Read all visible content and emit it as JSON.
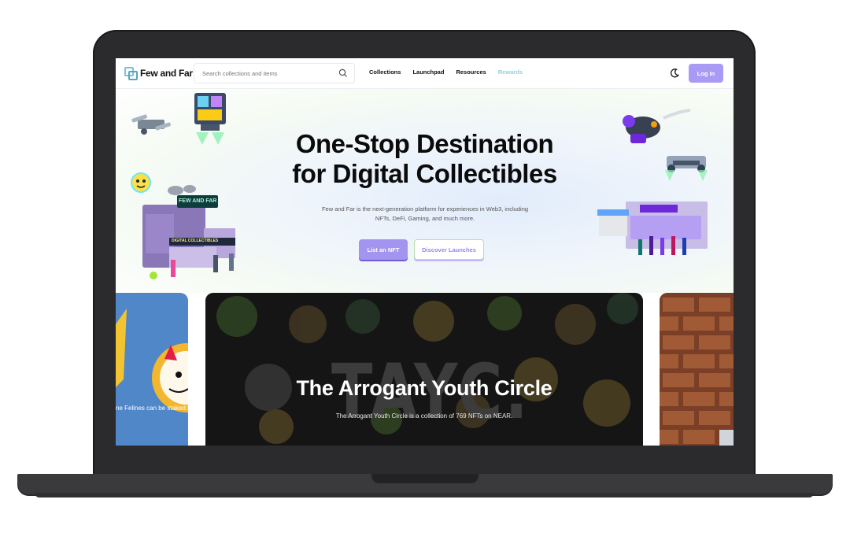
{
  "nav": {
    "logo_text": "Few and Far",
    "search_placeholder": "Search collections and items",
    "links": [
      {
        "label": "Collections"
      },
      {
        "label": "Launchpad"
      },
      {
        "label": "Resources"
      },
      {
        "label": "Rewards"
      }
    ],
    "login_label": "Log In"
  },
  "hero": {
    "title_line1": "One-Stop Destination",
    "title_line2": "for Digital Collectibles",
    "subtitle": "Few and Far is the next-generation platform for experiences in Web3, including NFTs, DeFi, Gaming, and much more.",
    "primary_button": "List an NFT",
    "secondary_button": "Discover Launches",
    "sign_text": "FEW AND FAR",
    "sign_text_2": "DIGITAL COLLECTIBLES"
  },
  "carousel": {
    "left_caption": "ne Felines can be staked to",
    "main_title": "The Arrogant Youth Circle",
    "main_desc": "The Arrogant Youth Circle is a collection of 769 NFTs on NEAR.",
    "main_bg_text": "TAYC."
  },
  "colors": {
    "accent": "#a394f0",
    "rewards": "#8fd3d8",
    "frame": "#2b2b2d"
  }
}
